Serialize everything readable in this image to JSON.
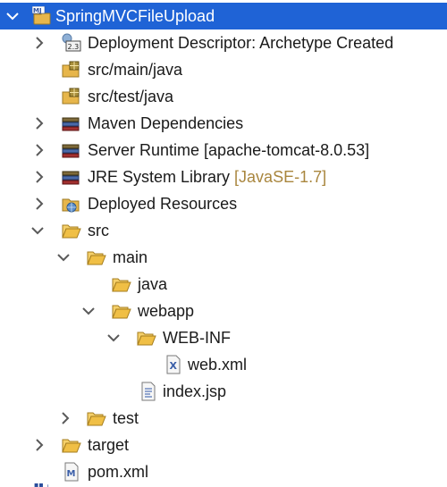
{
  "tree": {
    "project": {
      "label": "SpringMVCFileUpload",
      "badge": "MJ"
    },
    "items": [
      {
        "label": "Deployment Descriptor: Archetype Created",
        "badge": "2.3"
      },
      {
        "label": "src/main/java"
      },
      {
        "label": "src/test/java"
      },
      {
        "label": "Maven Dependencies"
      },
      {
        "label": "Server Runtime [apache-tomcat-8.0.53]"
      },
      {
        "label": "JRE System Library ",
        "decoration": "[JavaSE-1.7]"
      },
      {
        "label": "Deployed Resources"
      },
      {
        "label": "src"
      },
      {
        "label": "main"
      },
      {
        "label": "java"
      },
      {
        "label": "webapp"
      },
      {
        "label": "WEB-INF"
      },
      {
        "label": "web.xml",
        "badge": "X"
      },
      {
        "label": "index.jsp"
      },
      {
        "label": "test"
      },
      {
        "label": "target"
      },
      {
        "label": "pom.xml",
        "badge": "M"
      }
    ]
  },
  "colors": {
    "selection": "#1f63d6",
    "folder": "#e7b64b",
    "decoration": "#a9863e",
    "chevron": "#5a5a5a"
  },
  "icons": {
    "expanded": "chevron-down-icon",
    "collapsed": "chevron-right-icon",
    "folder": "folder-open-icon",
    "package": "package-folder-icon",
    "library": "library-icon",
    "xml": "xml-file-icon",
    "jsp": "jsp-file-icon",
    "maven": "maven-pom-icon"
  }
}
